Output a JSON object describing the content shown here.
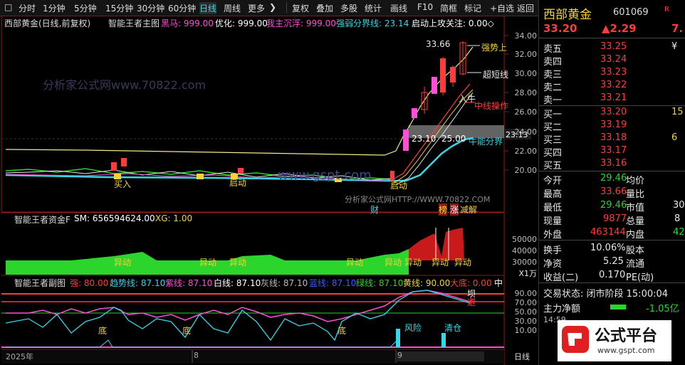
{
  "toolbar": {
    "items": [
      "分时",
      "1分钟",
      "5分钟",
      "15分钟",
      "30分钟",
      "60分钟",
      "日线",
      "周线",
      "更多"
    ],
    "buttons": [
      "复权",
      "叠加",
      "多股",
      "统计",
      "画线",
      "F10",
      "简框",
      "标记",
      "+自选",
      "返回"
    ]
  },
  "main": {
    "title": "西部黄金(日线,前复权)",
    "indicator": "智能王者主图",
    "legend": [
      {
        "text": "黑马: 999.00",
        "color": "#ff4fd6"
      },
      {
        "text": "优化: 999.00",
        "color": "#ffffff"
      },
      {
        "text": "我主沉浮: 999.00",
        "color": "#ff4fd6"
      },
      {
        "text": "强弱分界线: 23.14",
        "color": "#35d7e8"
      },
      {
        "text": "启动上攻关注: 0.00◇",
        "color": "#ffffff"
      }
    ],
    "yaxis": [
      "34.00",
      "32.00",
      "30.00",
      "28.00",
      "26.00",
      "24.00",
      "22.00",
      "20.00"
    ],
    "current_price_tag": "23.13",
    "annotations": {
      "high": "33.66",
      "trend": "强势上",
      "super_short": "超短线",
      "entry": "入牛",
      "mid_line": "中线操作",
      "bull": "牛能分界",
      "n2310": "23.10",
      "n2500": "25.00",
      "buy": "买入",
      "start1": "启动",
      "start2": "启动",
      "start3": "启动",
      "watermark": "分析家公式网HTTP://WWW.70822.COM",
      "wm_line": "分析家公式网www.70822.com",
      "site": "www.gspt.com",
      "cai": "财",
      "bang": "榜",
      "zhang": "涨",
      "jie": "减解"
    }
  },
  "sub1": {
    "title": "智能王者资金F",
    "sm": "SM: 656594624.00",
    "xg": "XG: 1.00",
    "yaxis": [
      "50000",
      "40000",
      "30000"
    ],
    "unit": "X1万",
    "yidong": [
      "异动",
      "异动",
      "异动",
      "异动",
      "异动",
      "异动",
      "异动",
      "异动"
    ]
  },
  "sub2": {
    "title": "智能王者副图",
    "legend": [
      {
        "text": "强: 80.00",
        "color": "#ff3b3b"
      },
      {
        "text": "趋势线: 87.10",
        "color": "#35d7e8"
      },
      {
        "text": "紫线: 87.10",
        "color": "#ff4fd6"
      },
      {
        "text": "白线: 87.10",
        "color": "#ffffff"
      },
      {
        "text": "灰线: 87.10",
        "color": "#bbbbbb"
      },
      {
        "text": "蓝线: 87.10",
        "color": "#3a5bff"
      },
      {
        "text": "绿线: 87.10",
        "color": "#2bd52b"
      },
      {
        "text": "黄线: 90.00",
        "color": "#f2d33a"
      },
      {
        "text": "大底: 0.00",
        "color": "#ff3b3b"
      },
      {
        "text": "中",
        "color": "#ffffff"
      }
    ],
    "yaxis": [
      "90.00",
      "70.00",
      "50.00",
      "30.00",
      "10.00"
    ],
    "markers": {
      "fengxian": "风险",
      "qingcang": "清仓",
      "zheng1": "坝",
      "zheng2": "避",
      "zhu1": "底",
      "zhu2": "底",
      "zhu3": "底"
    }
  },
  "xaxis": {
    "labels": [
      "2025年",
      "8",
      "9"
    ],
    "period": "日线"
  },
  "panel": {
    "name": "西部黄金",
    "code": "601069",
    "badge": "R",
    "price": "33.20",
    "change": "▲2.29",
    "pct": "7.",
    "sell": [
      {
        "l": "卖五",
        "p": "33.25",
        "v": "¥"
      },
      {
        "l": "卖四",
        "p": "33.24",
        "v": ""
      },
      {
        "l": "卖三",
        "p": "33.23",
        "v": ""
      },
      {
        "l": "卖二",
        "p": "33.22",
        "v": ""
      },
      {
        "l": "卖一",
        "p": "33.21",
        "v": ""
      }
    ],
    "buy": [
      {
        "l": "买一",
        "p": "33.20",
        "v": "15"
      },
      {
        "l": "买二",
        "p": "33.19",
        "v": ""
      },
      {
        "l": "买三",
        "p": "33.18",
        "v": "6"
      },
      {
        "l": "买四",
        "p": "33.17",
        "v": ""
      },
      {
        "l": "买五",
        "p": "33.16",
        "v": ""
      }
    ],
    "stats": [
      {
        "k": "今开",
        "v": "29.46",
        "k2": "均价",
        "v2": ""
      },
      {
        "k": "最高",
        "v": "33.66",
        "k2": "量比",
        "v2": ""
      },
      {
        "k": "最低",
        "v": "29.46",
        "k2": "市值",
        "v2": "30"
      },
      {
        "k": "现量",
        "v": "9877",
        "k2": "总量",
        "v2": "8"
      },
      {
        "k": "外盘",
        "v": "463144",
        "k2": "内盘",
        "v2": "42"
      }
    ],
    "stats2": [
      {
        "k": "换手",
        "v": "10.06%",
        "k2": "股本",
        "v2": ""
      },
      {
        "k": "净资",
        "v": "5.25",
        "k2": "流通",
        "v2": ""
      },
      {
        "k": "收益(二)",
        "v": "0.170",
        "k2": "PE(动)",
        "v2": ""
      }
    ],
    "trade_status": "交易状态: 闭市阶段 15:00:04",
    "main_net": "主力净额",
    "main_net_val": "-1.05亿",
    "time_row": "14:59",
    "logo_text": "公式平台",
    "logo_url": "www.gspt.com"
  }
}
